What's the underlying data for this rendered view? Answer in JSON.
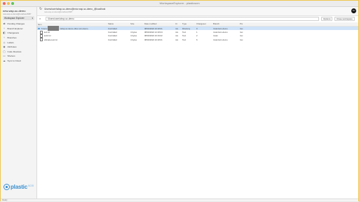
{
  "window": {
    "title": "WorkspaceExplorer - plasticscm",
    "lights": [
      "#ec6a5e",
      "#f4bf4f",
      "#61c554"
    ]
  },
  "sidebar": {
    "workspace_name": "new-wsp-sc-demo",
    "workspace_sub": "new-wsp-sc-demo@localhost:8087",
    "workspace_selector": "Workspace Explorer",
    "items": [
      {
        "label": "Pending Changes",
        "icon": "pending-changes-icon",
        "glyph": "⇄"
      },
      {
        "label": "Branch Explorer",
        "icon": "branch-icon",
        "glyph": "⑂"
      },
      {
        "label": "Changesets",
        "icon": "changeset-icon",
        "glyph": "◧"
      },
      {
        "label": "Branches",
        "icon": "branches-icon",
        "glyph": "⑂"
      },
      {
        "label": "Labels",
        "icon": "label-icon",
        "glyph": "◇"
      },
      {
        "label": "Attributes",
        "icon": "attribute-icon",
        "glyph": "◉"
      },
      {
        "label": "Code Reviews",
        "icon": "code-review-icon",
        "glyph": "▢"
      },
      {
        "label": "Shelves",
        "icon": "shelve-icon",
        "glyph": "▭"
      },
      {
        "label": "Sync to Cloud",
        "icon": "cloud-icon",
        "glyph": "☁"
      }
    ],
    "logo_word": "plastic",
    "logo_suffix": "scm"
  },
  "toolbar": {
    "path": "/Users/user/wksp-sc-demo@new-wsp-sc-demo_@localhost",
    "path_sub": "new-wsp-sc-demo@localhost:8087",
    "avatar": "UU"
  },
  "filter": {
    "value": "/Users/user/wksp-sc-demo",
    "options_label": "Options",
    "view_label": "Close workspace"
  },
  "table": {
    "headers": [
      "Item",
      "Status",
      "Size",
      "Date modified",
      "Ct",
      "Type",
      "Changeset",
      "Branch",
      "Pm"
    ],
    "rows": [
      {
        "kind": "folder",
        "item": "/Users/",
        "item2": "/wksp-sc-demo-other-scm-demo",
        "status": "Controlled",
        "size": "",
        "date": "08/02/2022 10:18:21",
        "ct": "n/a",
        "type": "Directory",
        "changeset": "0",
        "branch": "/main/scm-demo",
        "pm": "rwx",
        "selected": true
      },
      {
        "kind": "file",
        "item": "text.txt",
        "status": "Controlled",
        "size": "4 bytes",
        "date": "08/02/2022 12:18:24",
        "ct": "n/a",
        "type": "Text",
        "changeset": "1",
        "branch": "/main/scm-demo",
        "pm": "rwx",
        "selected": false
      },
      {
        "kind": "file",
        "item": "text2.txt",
        "status": "Controlled",
        "size": "4 bytes",
        "date": "08/02/2022 10:19:22",
        "ct": "n/a",
        "type": "Text",
        "changeset": "2",
        "branch": "/main",
        "pm": "rwx",
        "selected": false
      },
      {
        "kind": "file",
        "item": "ultimate-test.txt",
        "status": "Controlled",
        "size": "4 bytes",
        "date": "08/02/2022 10:18:21",
        "ct": "n/a",
        "type": "Text",
        "changeset": "6",
        "branch": "/main/scm-demo",
        "pm": "rwx",
        "selected": false
      }
    ]
  },
  "status": {
    "text": "Ready"
  }
}
